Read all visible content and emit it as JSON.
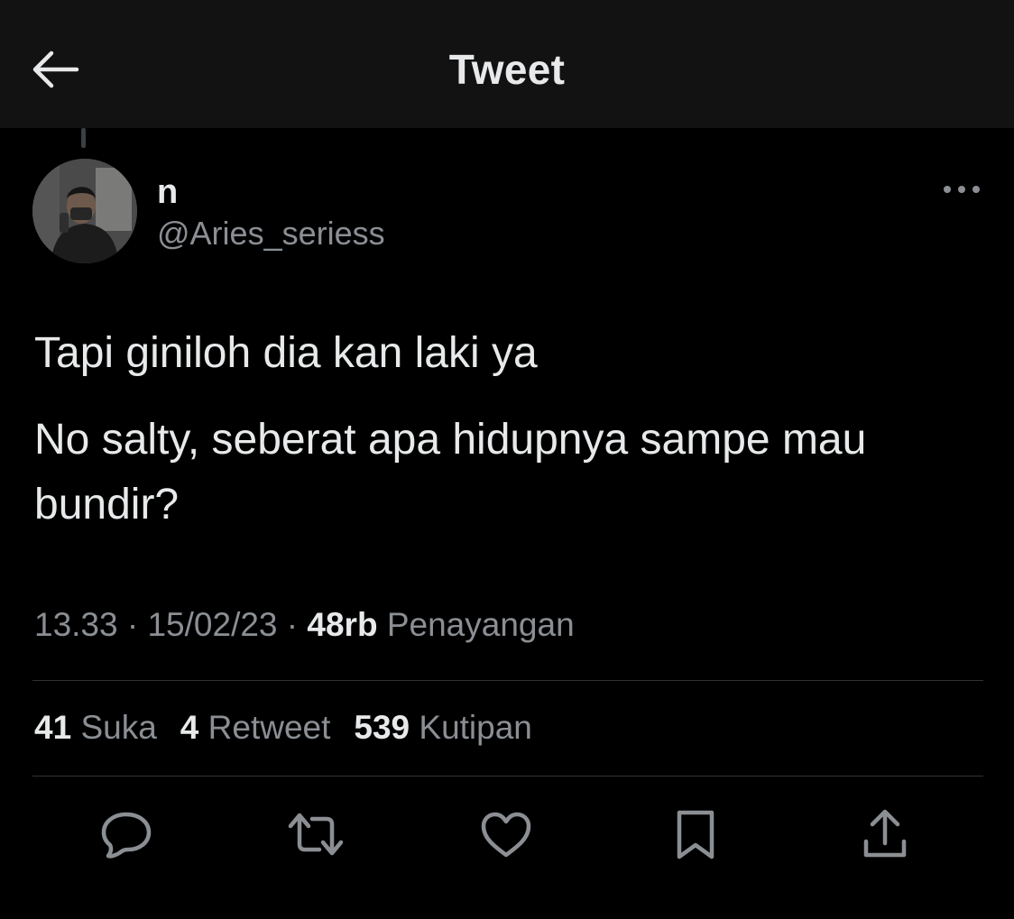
{
  "header": {
    "title": "Tweet",
    "back_icon": "arrow-left-icon"
  },
  "tweet": {
    "author": {
      "display_name": "n",
      "handle": "@Aries_seriess"
    },
    "more_icon": "more-horizontal-icon",
    "text": {
      "line1": "Tapi giniloh dia kan laki ya",
      "line2": "No salty, seberat apa hidupnya sampe mau bundir?"
    },
    "meta": {
      "time": "13.33",
      "separator1": " · ",
      "date": "15/02/23",
      "separator2": " · ",
      "views_count": "48rb",
      "views_label": "Penayangan"
    },
    "stats": {
      "likes_count": "41",
      "likes_label": "Suka",
      "retweets_count": "4",
      "retweets_label": "Retweet",
      "quotes_count": "539",
      "quotes_label": "Kutipan"
    },
    "actions": {
      "reply_icon": "reply-icon",
      "retweet_icon": "retweet-icon",
      "like_icon": "heart-icon",
      "bookmark_icon": "bookmark-icon",
      "share_icon": "share-icon"
    }
  },
  "colors": {
    "background": "#000000",
    "header_background": "#121212",
    "primary_text": "#e7e9ea",
    "secondary_text": "#8b8f94",
    "divider": "#2f3336"
  }
}
